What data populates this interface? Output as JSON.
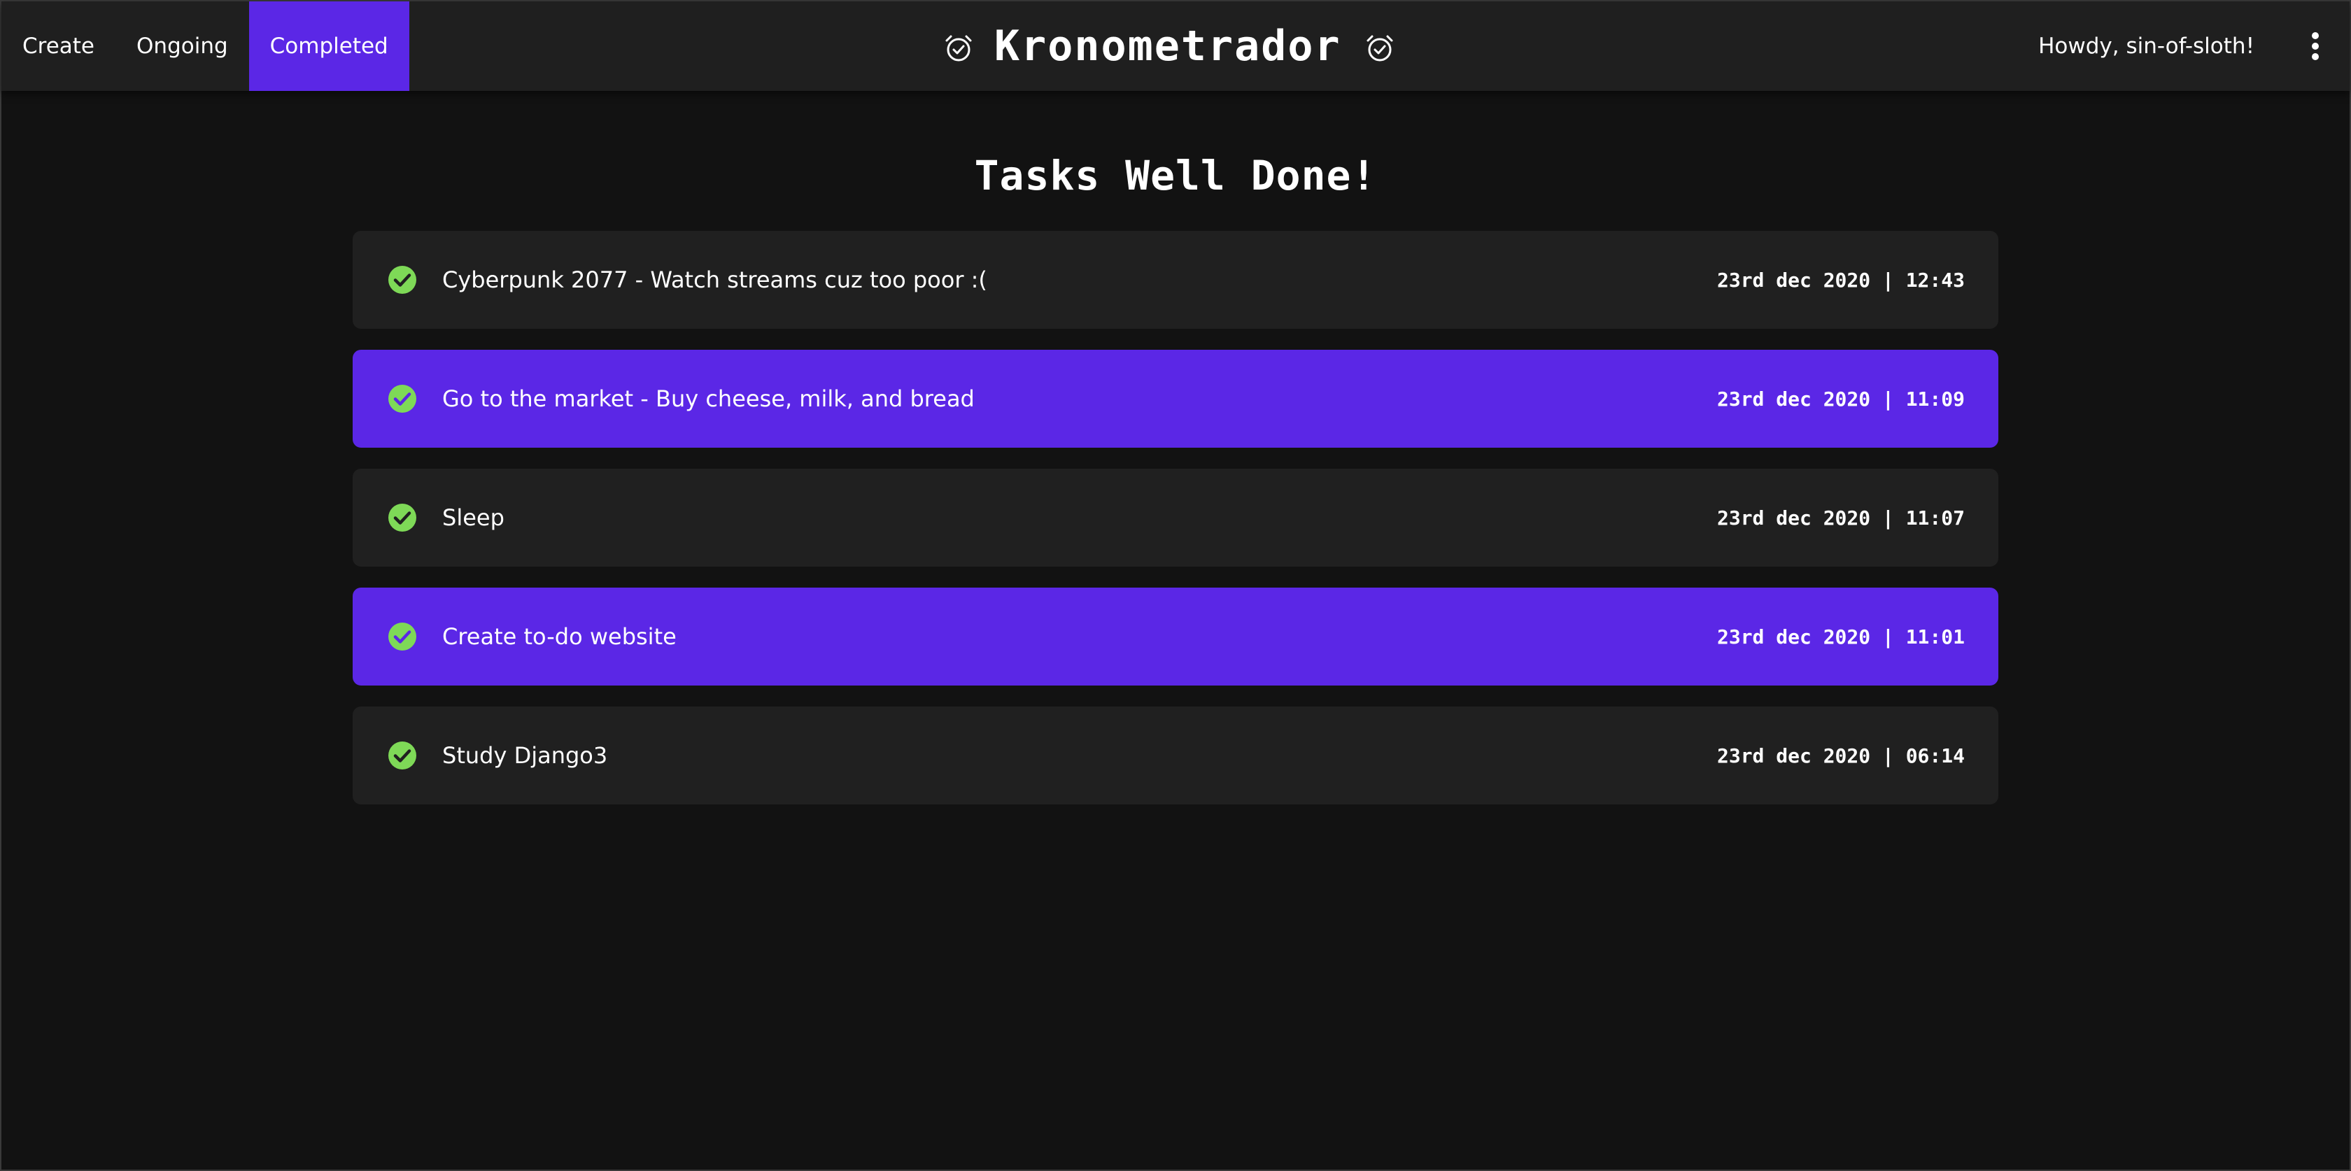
{
  "nav": {
    "links": [
      "Create",
      "Ongoing",
      "Completed"
    ],
    "active": "Completed",
    "accent_color": "#5b27e6"
  },
  "brand": {
    "title": "Kronometrador",
    "icon": "alarm-clock-check-icon"
  },
  "user": {
    "greeting": "Howdy, sin-of-sloth!",
    "menu_icon": "kebab-menu-icon"
  },
  "main": {
    "heading": "Tasks Well Done!",
    "tasks": [
      {
        "title": "Cyberpunk 2077 - Watch streams cuz too poor :(",
        "completed_at": "23rd dec 2020 | 12:43"
      },
      {
        "title": "Go to the market - Buy cheese, milk, and bread",
        "completed_at": "23rd dec 2020 | 11:09"
      },
      {
        "title": "Sleep",
        "completed_at": "23rd dec 2020 | 11:07"
      },
      {
        "title": "Create to-do website",
        "completed_at": "23rd dec 2020 | 11:01"
      },
      {
        "title": "Study Django3",
        "completed_at": "23rd dec 2020 | 06:14"
      }
    ],
    "check_icon": "check-circle-icon",
    "check_color": "#7ed957"
  }
}
